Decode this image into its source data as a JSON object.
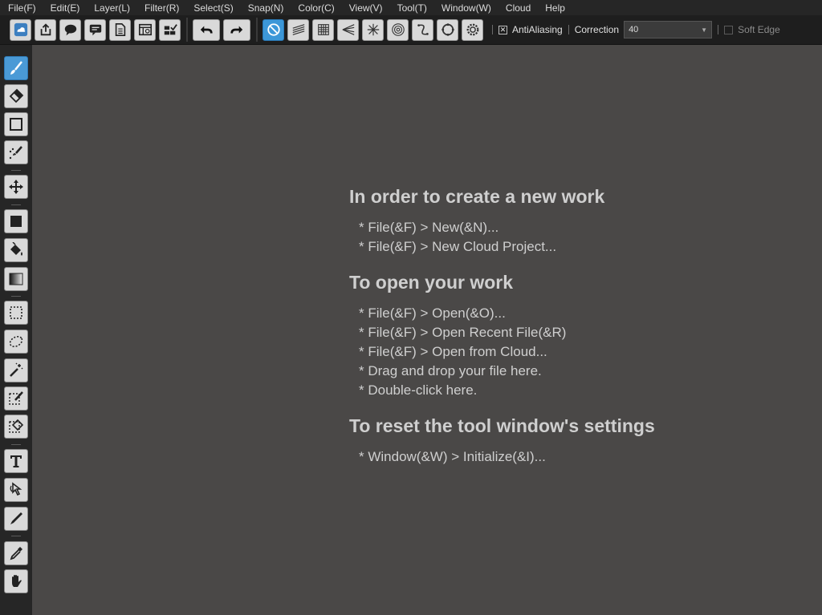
{
  "menu": [
    {
      "label": "File(F)"
    },
    {
      "label": "Edit(E)"
    },
    {
      "label": "Layer(L)"
    },
    {
      "label": "Filter(R)"
    },
    {
      "label": "Select(S)"
    },
    {
      "label": "Snap(N)"
    },
    {
      "label": "Color(C)"
    },
    {
      "label": "View(V)"
    },
    {
      "label": "Tool(T)"
    },
    {
      "label": "Window(W)"
    },
    {
      "label": "Cloud"
    },
    {
      "label": "Help"
    }
  ],
  "toolbar": {
    "file_icons": [
      "cloud-save-icon",
      "export-icon",
      "speech-bubble-icon",
      "comment-icon",
      "document-icon",
      "layout-icon",
      "checklist-icon"
    ],
    "history_icons": [
      "undo-icon",
      "redo-icon"
    ],
    "snap_icons": [
      "snap-off-icon",
      "parallel-lines-icon",
      "grid-icon",
      "perspective-icon",
      "radial-icon",
      "concentric-icon",
      "curve-icon",
      "circle-icon",
      "settings-icon"
    ],
    "antialiasing": {
      "label": "AntiAliasing",
      "checked": true,
      "mark": "✕"
    },
    "correction": {
      "label": "Correction",
      "value": "40"
    },
    "soft_edge": {
      "label": "Soft Edge",
      "checked": false
    }
  },
  "tools": [
    {
      "icon": "brush-icon",
      "active": true
    },
    {
      "icon": "eraser-icon",
      "active": false
    },
    {
      "icon": "rectangle-icon",
      "active": false
    },
    {
      "icon": "dotted-brush-icon",
      "active": false
    },
    {
      "icon": "move-icon",
      "active": false
    },
    {
      "icon": "fill-square-icon",
      "active": false
    },
    {
      "icon": "bucket-icon",
      "active": false
    },
    {
      "icon": "gradient-icon",
      "active": false
    },
    {
      "icon": "rect-select-icon",
      "active": false
    },
    {
      "icon": "lasso-icon",
      "active": false
    },
    {
      "icon": "magic-wand-icon",
      "active": false
    },
    {
      "icon": "select-pen-icon",
      "active": false
    },
    {
      "icon": "select-eraser-icon",
      "active": false
    },
    {
      "icon": "text-icon",
      "active": false
    },
    {
      "icon": "operation-icon",
      "active": false
    },
    {
      "icon": "pen-icon",
      "active": false
    },
    {
      "icon": "eyedropper-icon",
      "active": false
    },
    {
      "icon": "hand-icon",
      "active": false
    }
  ],
  "guide": {
    "sections": [
      {
        "heading": "In order to create a new work",
        "lines": [
          "* File(&F) > New(&N)...",
          "* File(&F) > New Cloud Project..."
        ]
      },
      {
        "heading": "To open your work",
        "lines": [
          "* File(&F) > Open(&O)...",
          "* File(&F) > Open Recent File(&R)",
          "* File(&F) > Open from Cloud...",
          "* Drag and drop your file here.",
          "* Double-click here."
        ]
      },
      {
        "heading": "To reset the tool window's settings",
        "lines": [
          "* Window(&W) > Initialize(&I)..."
        ]
      }
    ]
  },
  "colors": {
    "accent": "#3c97d8",
    "canvas": "#4a4847",
    "panel": "#262626"
  }
}
